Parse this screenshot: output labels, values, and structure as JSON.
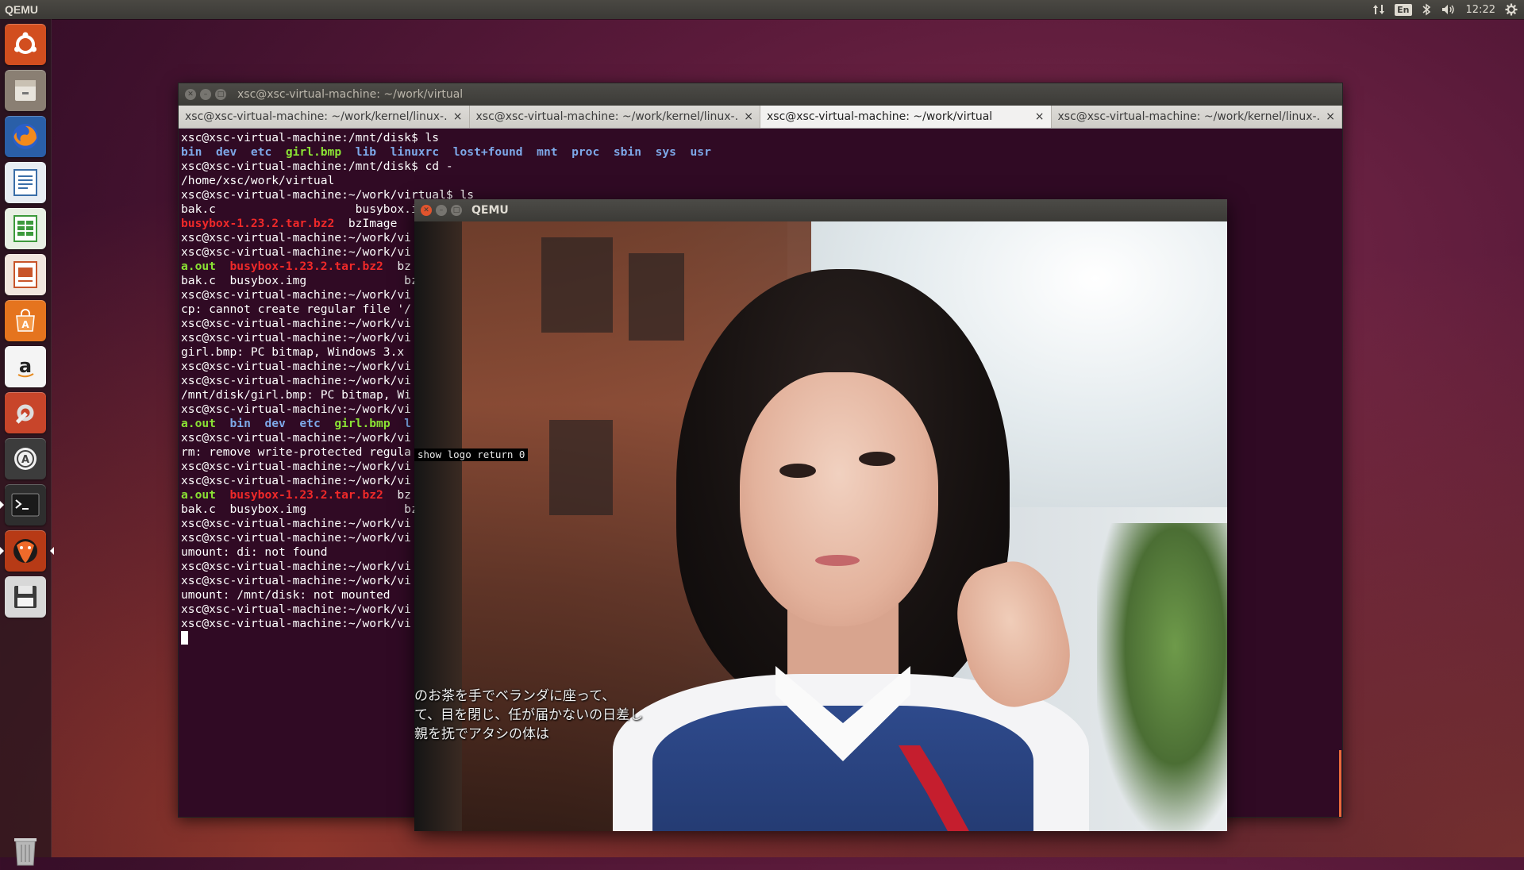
{
  "top_panel": {
    "app_name": "QEMU",
    "lang_indicator": "En",
    "network_icon": "up-down-arrows-icon",
    "bluetooth_icon": "bluetooth-icon",
    "volume_icon": "speaker-icon",
    "clock": "12:22",
    "settings_icon": "gear-icon"
  },
  "launcher": {
    "items": [
      {
        "name": "ubuntu-dash",
        "icon": "ubuntu-logo-icon",
        "color": "#d24e1f"
      },
      {
        "name": "files",
        "icon": "file-cabinet-icon",
        "color": "#8a7f73"
      },
      {
        "name": "firefox",
        "icon": "firefox-icon",
        "color": "#e56b1f"
      },
      {
        "name": "libreoffice-writer",
        "icon": "document-icon",
        "color": "#3a6ea8"
      },
      {
        "name": "libreoffice-calc",
        "icon": "spreadsheet-icon",
        "color": "#3c9a3c"
      },
      {
        "name": "libreoffice-impress",
        "icon": "presentation-icon",
        "color": "#c8552a"
      },
      {
        "name": "ubuntu-software",
        "icon": "shopping-bag-icon",
        "color": "#e5741e"
      },
      {
        "name": "amazon",
        "icon": "amazon-icon",
        "color": "#e8e8e8"
      },
      {
        "name": "system-settings",
        "icon": "tools-icon",
        "color": "#c8452a"
      },
      {
        "name": "software-updater",
        "icon": "updater-icon",
        "color": "#4a4a4a"
      },
      {
        "name": "terminal",
        "icon": "terminal-icon",
        "color": "#3a3a3a"
      },
      {
        "name": "qemu",
        "icon": "qemu-icon",
        "color": "#d84a1a"
      },
      {
        "name": "save",
        "icon": "floppy-icon",
        "color": "#cfcfcf"
      }
    ],
    "trash_icon": "trash-icon"
  },
  "terminal": {
    "title": "xsc@xsc-virtual-machine: ~/work/virtual",
    "tabs": [
      {
        "label": "xsc@xsc-virtual-machine: ~/work/kernel/linux-...",
        "active": false
      },
      {
        "label": "xsc@xsc-virtual-machine: ~/work/kernel/linux-...",
        "active": false
      },
      {
        "label": "xsc@xsc-virtual-machine: ~/work/virtual",
        "active": true
      },
      {
        "label": "xsc@xsc-virtual-machine: ~/work/kernel/linux-...",
        "active": false
      }
    ],
    "tab_close": "×",
    "lines": [
      [
        {
          "t": "xsc@xsc-virtual-machine:/mnt/disk$ ls",
          "c": ""
        }
      ],
      [
        {
          "t": "bin",
          "c": "blue"
        },
        {
          "t": "  ",
          "c": ""
        },
        {
          "t": "dev",
          "c": "blue"
        },
        {
          "t": "  ",
          "c": ""
        },
        {
          "t": "etc",
          "c": "blue"
        },
        {
          "t": "  ",
          "c": ""
        },
        {
          "t": "girl.bmp",
          "c": "green"
        },
        {
          "t": "  ",
          "c": ""
        },
        {
          "t": "lib",
          "c": "blue"
        },
        {
          "t": "  ",
          "c": ""
        },
        {
          "t": "linuxrc",
          "c": "blue"
        },
        {
          "t": "  ",
          "c": ""
        },
        {
          "t": "lost+found",
          "c": "blue"
        },
        {
          "t": "  ",
          "c": ""
        },
        {
          "t": "mnt",
          "c": "blue"
        },
        {
          "t": "  ",
          "c": ""
        },
        {
          "t": "proc",
          "c": "blue"
        },
        {
          "t": "  ",
          "c": ""
        },
        {
          "t": "sbin",
          "c": "blue"
        },
        {
          "t": "  ",
          "c": ""
        },
        {
          "t": "sys",
          "c": "blue"
        },
        {
          "t": "  ",
          "c": ""
        },
        {
          "t": "usr",
          "c": "blue"
        }
      ],
      [
        {
          "t": "xsc@xsc-virtual-machine:/mnt/disk$ cd -",
          "c": ""
        }
      ],
      [
        {
          "t": "/home/xsc/work/virtual",
          "c": ""
        }
      ],
      [
        {
          "t": "xsc@xsc-virtual-machine:~/work/virtual$ ls",
          "c": ""
        }
      ],
      [
        {
          "t": "bak.c                    busybox.i",
          "c": ""
        }
      ],
      [
        {
          "t": "busybox-1.23.2.tar.bz2",
          "c": "red"
        },
        {
          "t": "  bzImage",
          "c": ""
        }
      ],
      [
        {
          "t": "xsc@xsc-virtual-machine:~/work/vi",
          "c": ""
        }
      ],
      [
        {
          "t": "xsc@xsc-virtual-machine:~/work/vi",
          "c": ""
        }
      ],
      [
        {
          "t": "a.out",
          "c": "green"
        },
        {
          "t": "  ",
          "c": ""
        },
        {
          "t": "busybox-1.23.2.tar.bz2",
          "c": "red"
        },
        {
          "t": "  bz",
          "c": ""
        }
      ],
      [
        {
          "t": "bak.c  busybox.img              bz",
          "c": ""
        }
      ],
      [
        {
          "t": "xsc@xsc-virtual-machine:~/work/vi",
          "c": ""
        }
      ],
      [
        {
          "t": "cp: cannot create regular file '/",
          "c": ""
        }
      ],
      [
        {
          "t": "xsc@xsc-virtual-machine:~/work/vi",
          "c": ""
        }
      ],
      [
        {
          "t": "xsc@xsc-virtual-machine:~/work/vi",
          "c": ""
        }
      ],
      [
        {
          "t": "girl.bmp: PC bitmap, Windows 3.x ",
          "c": ""
        }
      ],
      [
        {
          "t": "xsc@xsc-virtual-machine:~/work/vi",
          "c": ""
        }
      ],
      [
        {
          "t": "xsc@xsc-virtual-machine:~/work/vi",
          "c": ""
        }
      ],
      [
        {
          "t": "/mnt/disk/girl.bmp: PC bitmap, Wi",
          "c": ""
        }
      ],
      [
        {
          "t": "xsc@xsc-virtual-machine:~/work/vi",
          "c": ""
        }
      ],
      [
        {
          "t": "a.out",
          "c": "green"
        },
        {
          "t": "  ",
          "c": ""
        },
        {
          "t": "bin",
          "c": "blue"
        },
        {
          "t": "  ",
          "c": ""
        },
        {
          "t": "dev",
          "c": "blue"
        },
        {
          "t": "  ",
          "c": ""
        },
        {
          "t": "etc",
          "c": "blue"
        },
        {
          "t": "  ",
          "c": ""
        },
        {
          "t": "girl.bmp",
          "c": "green"
        },
        {
          "t": "  l",
          "c": "blue"
        }
      ],
      [
        {
          "t": "xsc@xsc-virtual-machine:~/work/vi",
          "c": ""
        }
      ],
      [
        {
          "t": "rm: remove write-protected regula",
          "c": ""
        }
      ],
      [
        {
          "t": "xsc@xsc-virtual-machine:~/work/vi",
          "c": ""
        }
      ],
      [
        {
          "t": "xsc@xsc-virtual-machine:~/work/vi",
          "c": ""
        }
      ],
      [
        {
          "t": "a.out",
          "c": "green"
        },
        {
          "t": "  ",
          "c": ""
        },
        {
          "t": "busybox-1.23.2.tar.bz2",
          "c": "red"
        },
        {
          "t": "  bz",
          "c": ""
        }
      ],
      [
        {
          "t": "bak.c  busybox.img              bz",
          "c": ""
        }
      ],
      [
        {
          "t": "xsc@xsc-virtual-machine:~/work/vi",
          "c": ""
        }
      ],
      [
        {
          "t": "xsc@xsc-virtual-machine:~/work/vi",
          "c": ""
        }
      ],
      [
        {
          "t": "umount: di: not found",
          "c": ""
        }
      ],
      [
        {
          "t": "xsc@xsc-virtual-machine:~/work/vi",
          "c": ""
        }
      ],
      [
        {
          "t": "xsc@xsc-virtual-machine:~/work/vi",
          "c": ""
        }
      ],
      [
        {
          "t": "umount: /mnt/disk: not mounted",
          "c": ""
        }
      ],
      [
        {
          "t": "xsc@xsc-virtual-machine:~/work/vi",
          "c": ""
        }
      ],
      [
        {
          "t": "xsc@xsc-virtual-machine:~/work/vi",
          "c": ""
        }
      ]
    ]
  },
  "qemu": {
    "title": "QEMU",
    "console_text": "show logo return 0",
    "caption_lines": [
      "のお茶を手でベランダに座って、",
      "て、目を閉じ、任が届かないの日差し",
      "親を抚でアタシの体は"
    ]
  },
  "colors": {
    "terminal_bg": "#300a24",
    "term_blue": "#7da8e8",
    "term_green": "#8ae234",
    "term_red": "#ef2929",
    "ubuntu_orange": "#e96b3a"
  }
}
